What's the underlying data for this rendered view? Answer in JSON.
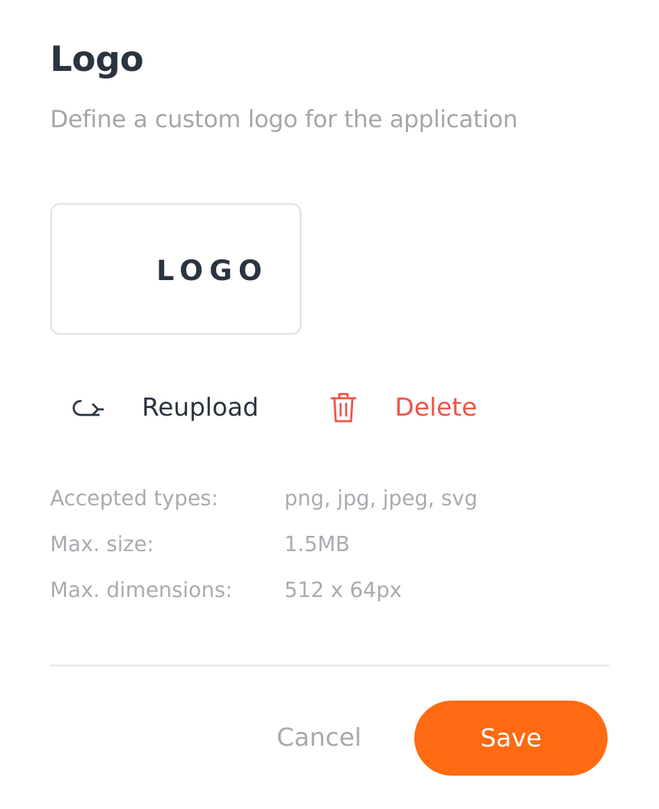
{
  "header": {
    "title": "Logo",
    "subtitle": "Define a custom logo for the application"
  },
  "logo_preview": {
    "wordmark": "LOGO",
    "mark_icon": "equalizer-bars-icon",
    "gradient_colors": [
      "#3b36c8",
      "#3d8bf0",
      "#7fe07a"
    ]
  },
  "actions": {
    "reupload": {
      "label": "Reupload",
      "icon": "redo-arrow-icon"
    },
    "delete": {
      "label": "Delete",
      "icon": "trash-icon",
      "color": "#f0524a"
    }
  },
  "requirements": [
    {
      "key": "Accepted types:",
      "value": "png, jpg, jpeg, svg"
    },
    {
      "key": "Max. size:",
      "value": "1.5MB"
    },
    {
      "key": "Max. dimensions:",
      "value": "512 x 64px"
    }
  ],
  "footer": {
    "cancel_label": "Cancel",
    "save_label": "Save",
    "save_color": "#ff6a13"
  }
}
